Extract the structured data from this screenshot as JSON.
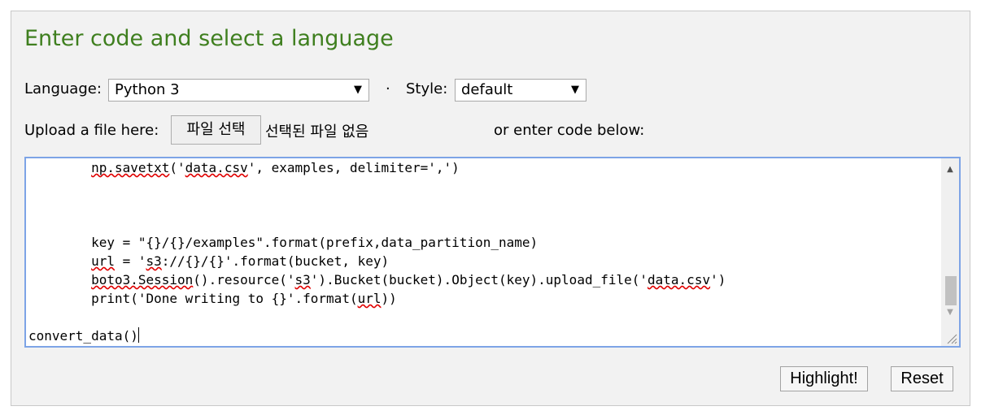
{
  "title": "Enter code and select a language",
  "language": {
    "label": "Language:",
    "selected": "Python 3"
  },
  "separator": "·",
  "style": {
    "label": "Style:",
    "selected": "default"
  },
  "upload": {
    "label": "Upload a file here:",
    "button_label": "파일 선택",
    "no_file_text": "선택된 파일 없음",
    "or_text": "or enter code below:"
  },
  "code_lines": [
    [
      {
        "t": "        "
      },
      {
        "t": "np.savetxt",
        "sq": true
      },
      {
        "t": "('"
      },
      {
        "t": "data.csv",
        "sq": true
      },
      {
        "t": "', examples, delimiter=',')"
      }
    ],
    [],
    [],
    [],
    [
      {
        "t": "        key = \"{}/{}/examples\".format(prefix,data_partition_name)"
      }
    ],
    [
      {
        "t": "        "
      },
      {
        "t": "url",
        "sq": true
      },
      {
        "t": " = '"
      },
      {
        "t": "s3",
        "sq": true
      },
      {
        "t": "://{}/{}'.format(bucket, key)"
      }
    ],
    [
      {
        "t": "        "
      },
      {
        "t": "boto3.Session",
        "sq": true
      },
      {
        "t": "().resource('"
      },
      {
        "t": "s3",
        "sq": true
      },
      {
        "t": "').Bucket(bucket).Object(key).upload_file('"
      },
      {
        "t": "data.csv",
        "sq": true
      },
      {
        "t": "')"
      }
    ],
    [
      {
        "t": "        print('Done writing to {}'.format("
      },
      {
        "t": "url",
        "sq": true
      },
      {
        "t": "))"
      }
    ],
    [],
    [
      {
        "t": "convert_data()"
      },
      {
        "caret": true
      }
    ]
  ],
  "buttons": {
    "highlight": "Highlight!",
    "reset": "Reset"
  }
}
